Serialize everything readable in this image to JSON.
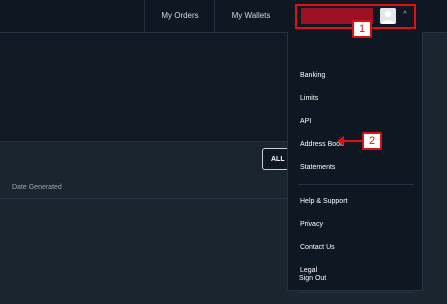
{
  "nav": {
    "orders_label": "My Orders",
    "wallets_label": "My Wallets"
  },
  "icons": {
    "avatar": "avatar-icon",
    "chevron": "chevron-up-icon",
    "arrow": "arrow-left-icon"
  },
  "filter": {
    "all_label": "ALL"
  },
  "table": {
    "columns": [
      "Date Generated"
    ]
  },
  "menu": {
    "items": [
      {
        "label": "Banking"
      },
      {
        "label": "Limits"
      },
      {
        "label": "API"
      },
      {
        "label": "Address Book"
      },
      {
        "label": "Statements"
      },
      {
        "label": "Help & Support"
      },
      {
        "label": "Privacy"
      },
      {
        "label": "Contact Us"
      },
      {
        "label": "Legal"
      },
      {
        "label": "Sign Out"
      }
    ]
  },
  "annotations": {
    "badge_1": "1",
    "badge_2": "2"
  },
  "colors": {
    "background": "#1b2530",
    "topbar": "#0f1722",
    "accent_red": "#e01010",
    "username_block": "#9b1024"
  }
}
